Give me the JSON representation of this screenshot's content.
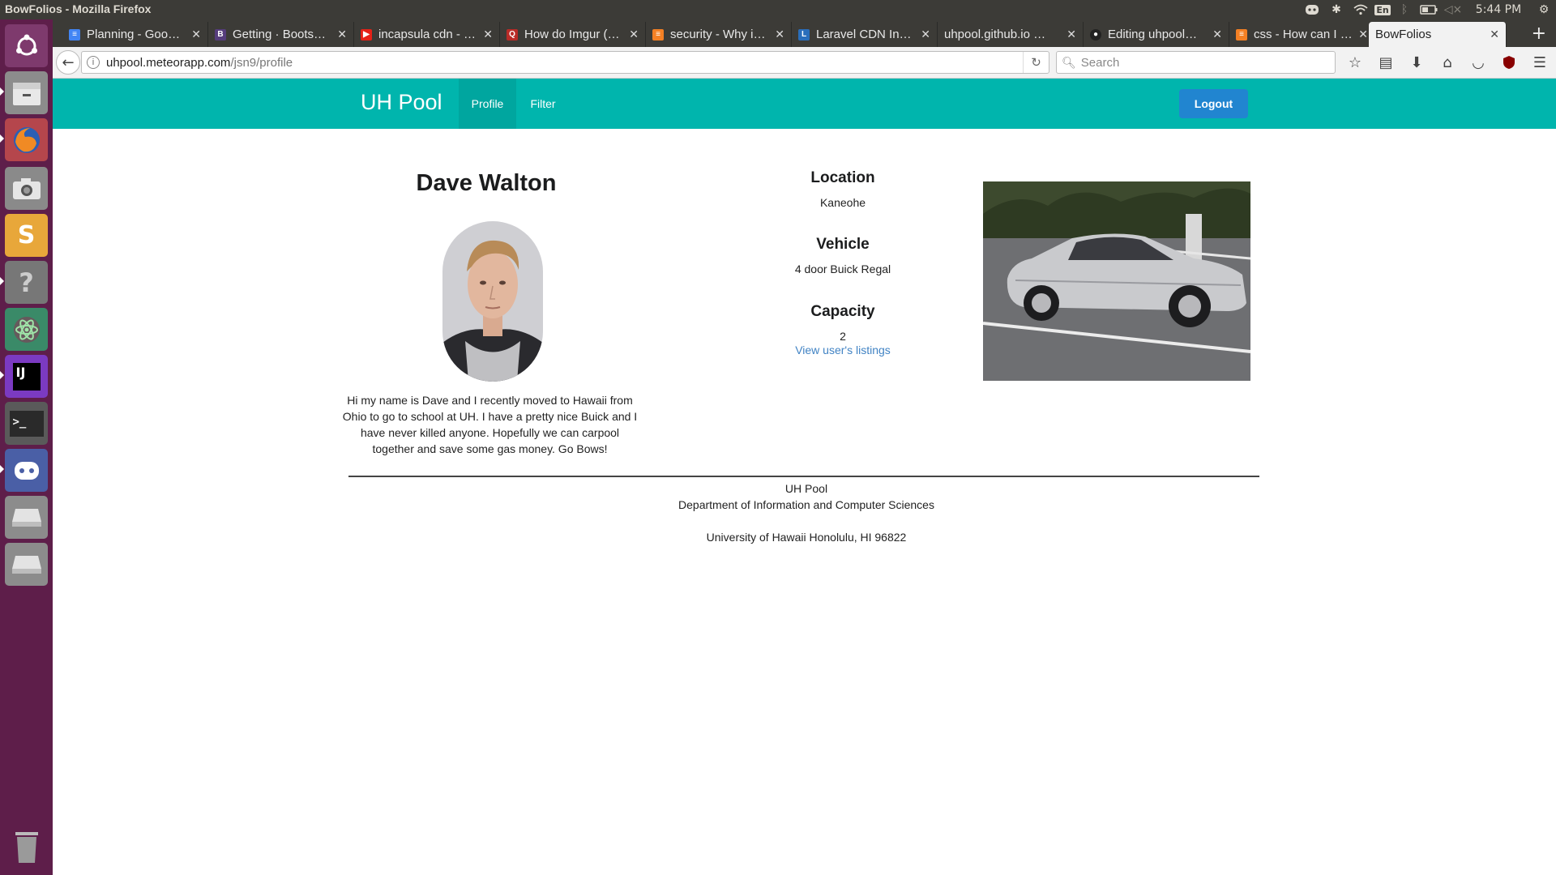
{
  "os": {
    "window_title": "BowFolios - Mozilla Firefox",
    "input_lang": "En",
    "clock": "5:44 PM"
  },
  "browser": {
    "tabs": [
      {
        "label": "Planning - Goo…",
        "icon": "google-docs-icon",
        "color": "#4285f4"
      },
      {
        "label": "Getting · Boots…",
        "icon": "bootstrap-icon",
        "color": "#563d7c"
      },
      {
        "label": "incapsula cdn - …",
        "icon": "youtube-icon",
        "color": "#e62117"
      },
      {
        "label": "How do Imgur (…",
        "icon": "quora-icon",
        "color": "#b92b27"
      },
      {
        "label": "security - Why i…",
        "icon": "stackoverflow-icon",
        "color": "#f48024"
      },
      {
        "label": "Laravel CDN In…",
        "icon": "laravel-icon",
        "color": "#2a6ebb"
      },
      {
        "label": "uhpool.github.io …",
        "icon": "page-icon",
        "color": "#888888"
      },
      {
        "label": "Editing uhpool…",
        "icon": "github-icon",
        "color": "#222222"
      },
      {
        "label": "css - How can I …",
        "icon": "stackoverflow-icon",
        "color": "#f48024"
      },
      {
        "label": "BowFolios",
        "icon": "page-icon",
        "color": "#cccccc"
      }
    ],
    "url_domain": "uhpool.meteorapp.com",
    "url_path": "/jsn9/profile",
    "search_placeholder": "Search"
  },
  "app": {
    "brand": "UH Pool",
    "menu": [
      {
        "label": "Profile",
        "active": true
      },
      {
        "label": "Filter",
        "active": false
      }
    ],
    "logout_label": "Logout",
    "accent_color": "#00b5ad",
    "button_color": "#2185d0"
  },
  "profile": {
    "name": "Dave Walton",
    "bio": "Hi my name is Dave and I recently moved to Hawaii from Ohio to go to school at UH. I have a pretty nice Buick and I have never killed anyone. Hopefully we can carpool together and save some gas money. Go Bows!",
    "location_heading": "Location",
    "location": "Kaneohe",
    "vehicle_heading": "Vehicle",
    "vehicle": "4 door Buick Regal",
    "capacity_heading": "Capacity",
    "capacity": "2",
    "listings_link": "View user's listings"
  },
  "footer": {
    "link": "UH Pool",
    "department": "Department of Information and Computer Sciences",
    "address": "University of Hawaii Honolulu, HI 96822"
  }
}
